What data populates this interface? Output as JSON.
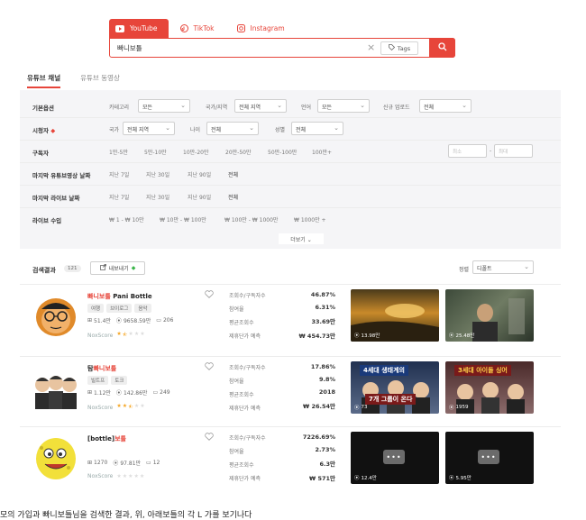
{
  "platform_tabs": [
    {
      "label": "YouTube",
      "icon": "youtube-icon",
      "active": true
    },
    {
      "label": "TikTok",
      "icon": "tiktok-icon",
      "active": false
    },
    {
      "label": "Instagram",
      "icon": "instagram-icon",
      "active": false
    }
  ],
  "search": {
    "value": "빠니보틀",
    "tags_label": "Tags"
  },
  "section_tabs": [
    "유튜브 채널",
    "유튜브 동영상"
  ],
  "filters": {
    "basic": {
      "label": "기본옵션",
      "category_label": "카테고리",
      "category_value": "모든",
      "country_label": "국가/지역",
      "country_value": "전체 지역",
      "language_label": "언어",
      "language_value": "모든",
      "upload_label": "신규 업로드",
      "upload_value": "전체"
    },
    "audience": {
      "label": "시청자",
      "country_label": "국가",
      "country_value": "전체 지역",
      "age_label": "나이",
      "age_value": "전체",
      "gender_label": "성별",
      "gender_value": "전체"
    },
    "subscribers": {
      "label": "구독자",
      "options": [
        "1만-5만",
        "5만-10만",
        "10만-20만",
        "20만-50만",
        "50만-100만",
        "100만+"
      ],
      "min_placeholder": "최소",
      "max_placeholder": "최대"
    },
    "last_upload": {
      "label": "마지막 유튜브영상 날짜",
      "options": [
        "지난 7일",
        "지난 30일",
        "지난 90일",
        "전체"
      ]
    },
    "last_live": {
      "label": "마지막 라이브 날짜",
      "options": [
        "지난 7일",
        "지난 30일",
        "지난 90일",
        "전체"
      ]
    },
    "live_income": {
      "label": "라이브 수입",
      "options": [
        "₩ 1 - ₩ 10만",
        "₩ 10만 - ₩ 100만",
        "₩ 100만 - ₩ 1000만",
        "₩ 1000만 +"
      ]
    },
    "more_label": "더보기"
  },
  "results": {
    "title": "검색결과",
    "count": "121",
    "export_label": "내보내기",
    "sort_label": "정렬",
    "sort_value": "디폴트",
    "metric_labels": [
      "조회수/구독자수",
      "참여율",
      "평균조회수",
      "제휴단가 예측"
    ],
    "noxscore_label": "NoxScore",
    "channels": [
      {
        "name_highlight": "빠니보틀",
        "name_rest": " Pani Bottle",
        "tags": [
          "여행",
          "브이로그",
          "음악"
        ],
        "subscribers": "51.4만",
        "views": "9658.59만",
        "videos": "206",
        "stars": 1.5,
        "metrics": [
          "46.87%",
          "6.31%",
          "33.69만",
          "₩ 454.73만"
        ],
        "thumb_views": [
          "13.98만",
          "25.48만"
        ]
      },
      {
        "name_highlight": "빠니보틀",
        "name_rest": "",
        "name_prefix": "탐",
        "tags": [
          "빌트프",
          "토크"
        ],
        "subscribers": "1.12만",
        "views": "142.86만",
        "videos": "249",
        "stars": 2.5,
        "metrics": [
          "17.86%",
          "9.8%",
          "2018",
          "₩ 26.54만"
        ],
        "thumb_views": [
          "73",
          "1959"
        ],
        "thumb_captions": [
          "4세대 생태계의",
          "7개 그룹이 온다",
          "3세대 아이돌 싱어"
        ]
      },
      {
        "name_highlight": "보틀",
        "name_prefix": "[bottle]",
        "name_rest": "",
        "tags": [],
        "subscribers": "1270",
        "views": "97.81만",
        "videos": "12",
        "stars": 0,
        "metrics": [
          "7226.69%",
          "2.73%",
          "6.3만",
          "₩ 571만"
        ],
        "thumb_views": [
          "12.4만",
          "5.95만"
        ]
      }
    ]
  },
  "bottom_text": "모의 가입과 빠니보틀님을 검색한 결과, 위, 아래보틀의 각 L 가를 보기나다"
}
